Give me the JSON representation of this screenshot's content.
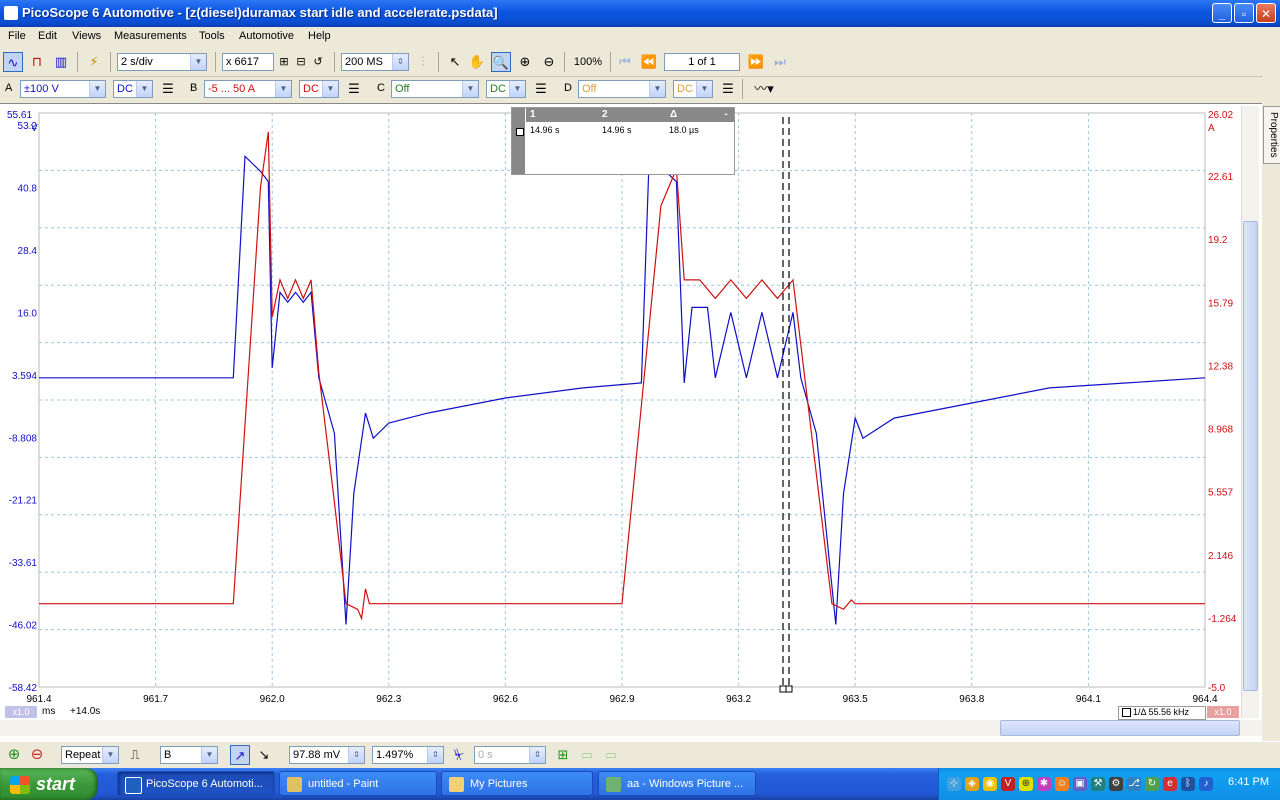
{
  "window": {
    "title": "PicoScope 6 Automotive - [z(diesel)duramax start idle and accelerate.psdata]"
  },
  "menu": [
    "File",
    "Edit",
    "Views",
    "Measurements",
    "Tools",
    "Automotive",
    "Help"
  ],
  "toolbar": {
    "timebase": "2 s/div",
    "zoom_factor": "x 6617",
    "samples": "200 MS",
    "zoom_pct": "100%",
    "buffer": "1 of 1"
  },
  "channels": {
    "a": {
      "label": "A",
      "range": "±100 V",
      "coupling": "DC"
    },
    "b": {
      "label": "B",
      "range": "-5 ... 50 A",
      "coupling": "DC"
    },
    "c": {
      "label": "C",
      "range": "Off",
      "coupling": "DC"
    },
    "d": {
      "label": "D",
      "range": "Off",
      "coupling": "DC"
    }
  },
  "axes": {
    "left_unit": "V",
    "right_unit": "A",
    "left_top": "55.61",
    "right_top": "26.02",
    "left_ticks": [
      "53.2",
      "40.8",
      "28.4",
      "16.0",
      "3.594",
      "-8.808",
      "-21.21",
      "-33.61",
      "-46.02",
      "-58.42"
    ],
    "right_ticks": [
      "22.61",
      "19.2",
      "15.79",
      "12.38",
      "8.968",
      "5.557",
      "2.146",
      "-1.264",
      "-5.0"
    ],
    "x_ticks": [
      "961.4",
      "961.7",
      "962.0",
      "962.3",
      "962.6",
      "962.9",
      "963.2",
      "963.5",
      "963.8",
      "964.1",
      "964.4"
    ],
    "x_unit": "ms",
    "x_offset": "+14.0s",
    "left_scale": "x1.0",
    "right_scale": "x1.0"
  },
  "rulers": {
    "headers": [
      "1",
      "2",
      "Δ",
      "-"
    ],
    "values": [
      "14.96 s",
      "14.96 s",
      "18.0 µs"
    ]
  },
  "freq_readout": "1/Δ 55.56 kHz",
  "colors": {
    "ch_a": "#1010c8",
    "ch_b": "#d01010",
    "grid": "#9cc8e0"
  },
  "bottom": {
    "trigger_mode": "Repeat",
    "trigger_channel": "B",
    "trigger_level": "97.88 mV",
    "pre_trigger": "1.497%",
    "post_delay": "0 s"
  },
  "taskbar": {
    "start": "start",
    "tasks": [
      "PicoScope 6 Automoti...",
      "untitled - Paint",
      "My Pictures",
      "aa - Windows Picture ..."
    ],
    "clock": "6:41 PM"
  },
  "properties_tab": "Properties",
  "chart_data": {
    "type": "line",
    "x_range": [
      961.4,
      964.4
    ],
    "ylim_left": [
      -58.42,
      55.61
    ],
    "ylim_right": [
      -5.0,
      26.02
    ],
    "grid": true,
    "series": [
      {
        "name": "A",
        "axis": "left",
        "color": "#1010c8",
        "points": [
          [
            961.4,
            3.0
          ],
          [
            961.9,
            3.0
          ],
          [
            961.93,
            47.0
          ],
          [
            961.97,
            44.0
          ],
          [
            961.99,
            42.0
          ],
          [
            962.0,
            5.0
          ],
          [
            962.02,
            20.0
          ],
          [
            962.04,
            18.0
          ],
          [
            962.06,
            20.0
          ],
          [
            962.08,
            18.0
          ],
          [
            962.1,
            20.0
          ],
          [
            962.12,
            3.0
          ],
          [
            962.16,
            -8.0
          ],
          [
            962.19,
            -46.0
          ],
          [
            962.21,
            -20.0
          ],
          [
            962.24,
            -4.0
          ],
          [
            962.26,
            -9.0
          ],
          [
            962.3,
            -6.0
          ],
          [
            962.4,
            -4.0
          ],
          [
            962.6,
            -1.0
          ],
          [
            962.8,
            1.0
          ],
          [
            962.95,
            2.0
          ],
          [
            962.97,
            47.0
          ],
          [
            963.04,
            42.0
          ],
          [
            963.06,
            2.0
          ],
          [
            963.08,
            17.0
          ],
          [
            963.12,
            17.0
          ],
          [
            963.14,
            3.0
          ],
          [
            963.18,
            16.0
          ],
          [
            963.22,
            3.0
          ],
          [
            963.26,
            16.0
          ],
          [
            963.3,
            3.0
          ],
          [
            963.34,
            16.0
          ],
          [
            963.36,
            3.0
          ],
          [
            963.4,
            -8.0
          ],
          [
            963.45,
            -46.0
          ],
          [
            963.47,
            -20.0
          ],
          [
            963.5,
            -5.0
          ],
          [
            963.52,
            -9.0
          ],
          [
            963.6,
            -5.0
          ],
          [
            963.8,
            -2.0
          ],
          [
            964.0,
            1.0
          ],
          [
            964.2,
            2.0
          ],
          [
            964.4,
            3.0
          ]
        ]
      },
      {
        "name": "B",
        "axis": "right",
        "color": "#d01010",
        "points": [
          [
            961.4,
            -0.5
          ],
          [
            961.9,
            -0.5
          ],
          [
            961.97,
            22.0
          ],
          [
            961.99,
            25.0
          ],
          [
            962.0,
            15.0
          ],
          [
            962.02,
            17.0
          ],
          [
            962.04,
            16.0
          ],
          [
            962.06,
            17.0
          ],
          [
            962.08,
            16.0
          ],
          [
            962.1,
            17.0
          ],
          [
            962.12,
            12.0
          ],
          [
            962.16,
            5.0
          ],
          [
            962.19,
            -0.5
          ],
          [
            962.22,
            -0.8
          ],
          [
            962.23,
            -1.3
          ],
          [
            962.24,
            0.3
          ],
          [
            962.25,
            -0.5
          ],
          [
            962.9,
            -0.5
          ],
          [
            963.0,
            21.0
          ],
          [
            963.04,
            23.0
          ],
          [
            963.06,
            17.0
          ],
          [
            963.1,
            17.0
          ],
          [
            963.14,
            16.0
          ],
          [
            963.18,
            17.0
          ],
          [
            963.22,
            16.0
          ],
          [
            963.26,
            17.0
          ],
          [
            963.3,
            16.0
          ],
          [
            963.34,
            17.0
          ],
          [
            963.38,
            10.0
          ],
          [
            963.44,
            -0.5
          ],
          [
            963.47,
            -0.8
          ],
          [
            963.49,
            -0.3
          ],
          [
            963.5,
            -0.5
          ],
          [
            964.4,
            -0.5
          ]
        ]
      }
    ]
  }
}
